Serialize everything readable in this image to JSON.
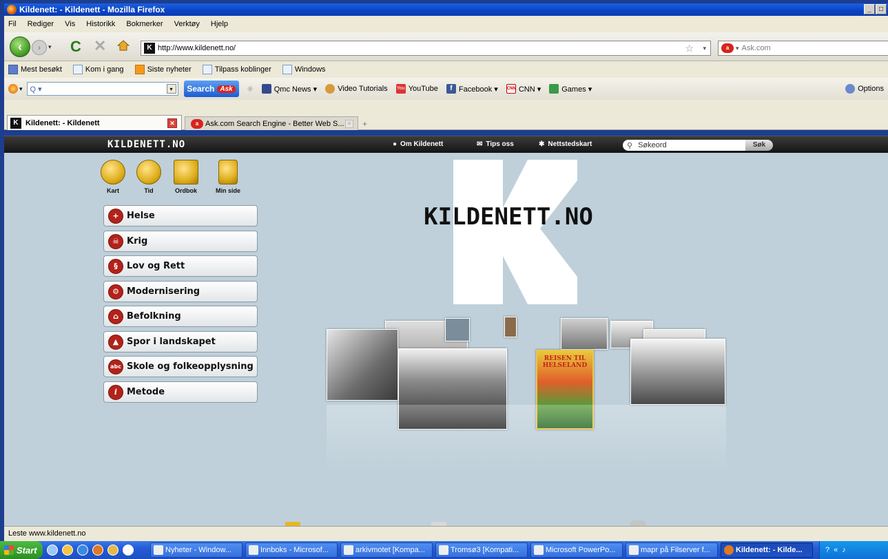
{
  "window": {
    "title": "Kildenett: - Kildenett - Mozilla Firefox",
    "min": "_",
    "max": "□"
  },
  "menu": [
    "Fil",
    "Rediger",
    "Vis",
    "Historikk",
    "Bokmerker",
    "Verktøy",
    "Hjelp"
  ],
  "nav": {
    "url": "http://www.kildenett.no/",
    "search_placeholder": "Ask.com"
  },
  "bookmarks": [
    "Mest besøkt",
    "Kom i gang",
    "Siste nyheter",
    "Tilpass koblinger",
    "Windows"
  ],
  "asktoolbar": {
    "search_value": "Q ▾",
    "search_btn": "Search",
    "ask_logo": "Ask",
    "items": [
      "Qmc News ▾",
      "Video Tutorials",
      "YouTube",
      "Facebook ▾",
      "CNN ▾",
      "Games ▾"
    ],
    "options": "Options"
  },
  "tabs": [
    {
      "label": "Kildenett: - Kildenett"
    },
    {
      "label": "Ask.com Search Engine - Better Web S..."
    }
  ],
  "site": {
    "logo": "KILDENETT.NO",
    "links": [
      "Om Kildenett",
      "Tips oss",
      "Nettstedskart"
    ],
    "search_placeholder": "Søkeord",
    "search_btn": "Søk",
    "quick_icons": [
      "Kart",
      "Tid",
      "Ordbok",
      "Min side"
    ],
    "menu": [
      {
        "label": "Helse",
        "icon": "+"
      },
      {
        "label": "Krig",
        "icon": "☠"
      },
      {
        "label": "Lov og Rett",
        "icon": "§"
      },
      {
        "label": "Modernisering",
        "icon": "⚙"
      },
      {
        "label": "Befolkning",
        "icon": "⌂"
      },
      {
        "label": "Spor i landskapet",
        "icon": "▲"
      },
      {
        "label": "Skole og folkeopplysning",
        "icon": "abc"
      },
      {
        "label": "Metode",
        "icon": "i"
      }
    ],
    "biglogo_text": "KILDENETT.NO",
    "book_title": "REISEN TIL HELSELAND"
  },
  "status": "Leste www.kildenett.no",
  "taskbar": {
    "start": "Start",
    "tasks": [
      "Nyheter - Window...",
      "Innboks - Microsof...",
      "arkivmotet [Kompa...",
      "Tromsø3 [Kompati...",
      "Microsoft PowerPo...",
      "mapr på Filserver f...",
      "Kildenett: - Kilde..."
    ]
  },
  "colors": {
    "accent": "#b3221a",
    "content_bg": "#bfd0da",
    "header_bg": "#1f1f1f"
  }
}
